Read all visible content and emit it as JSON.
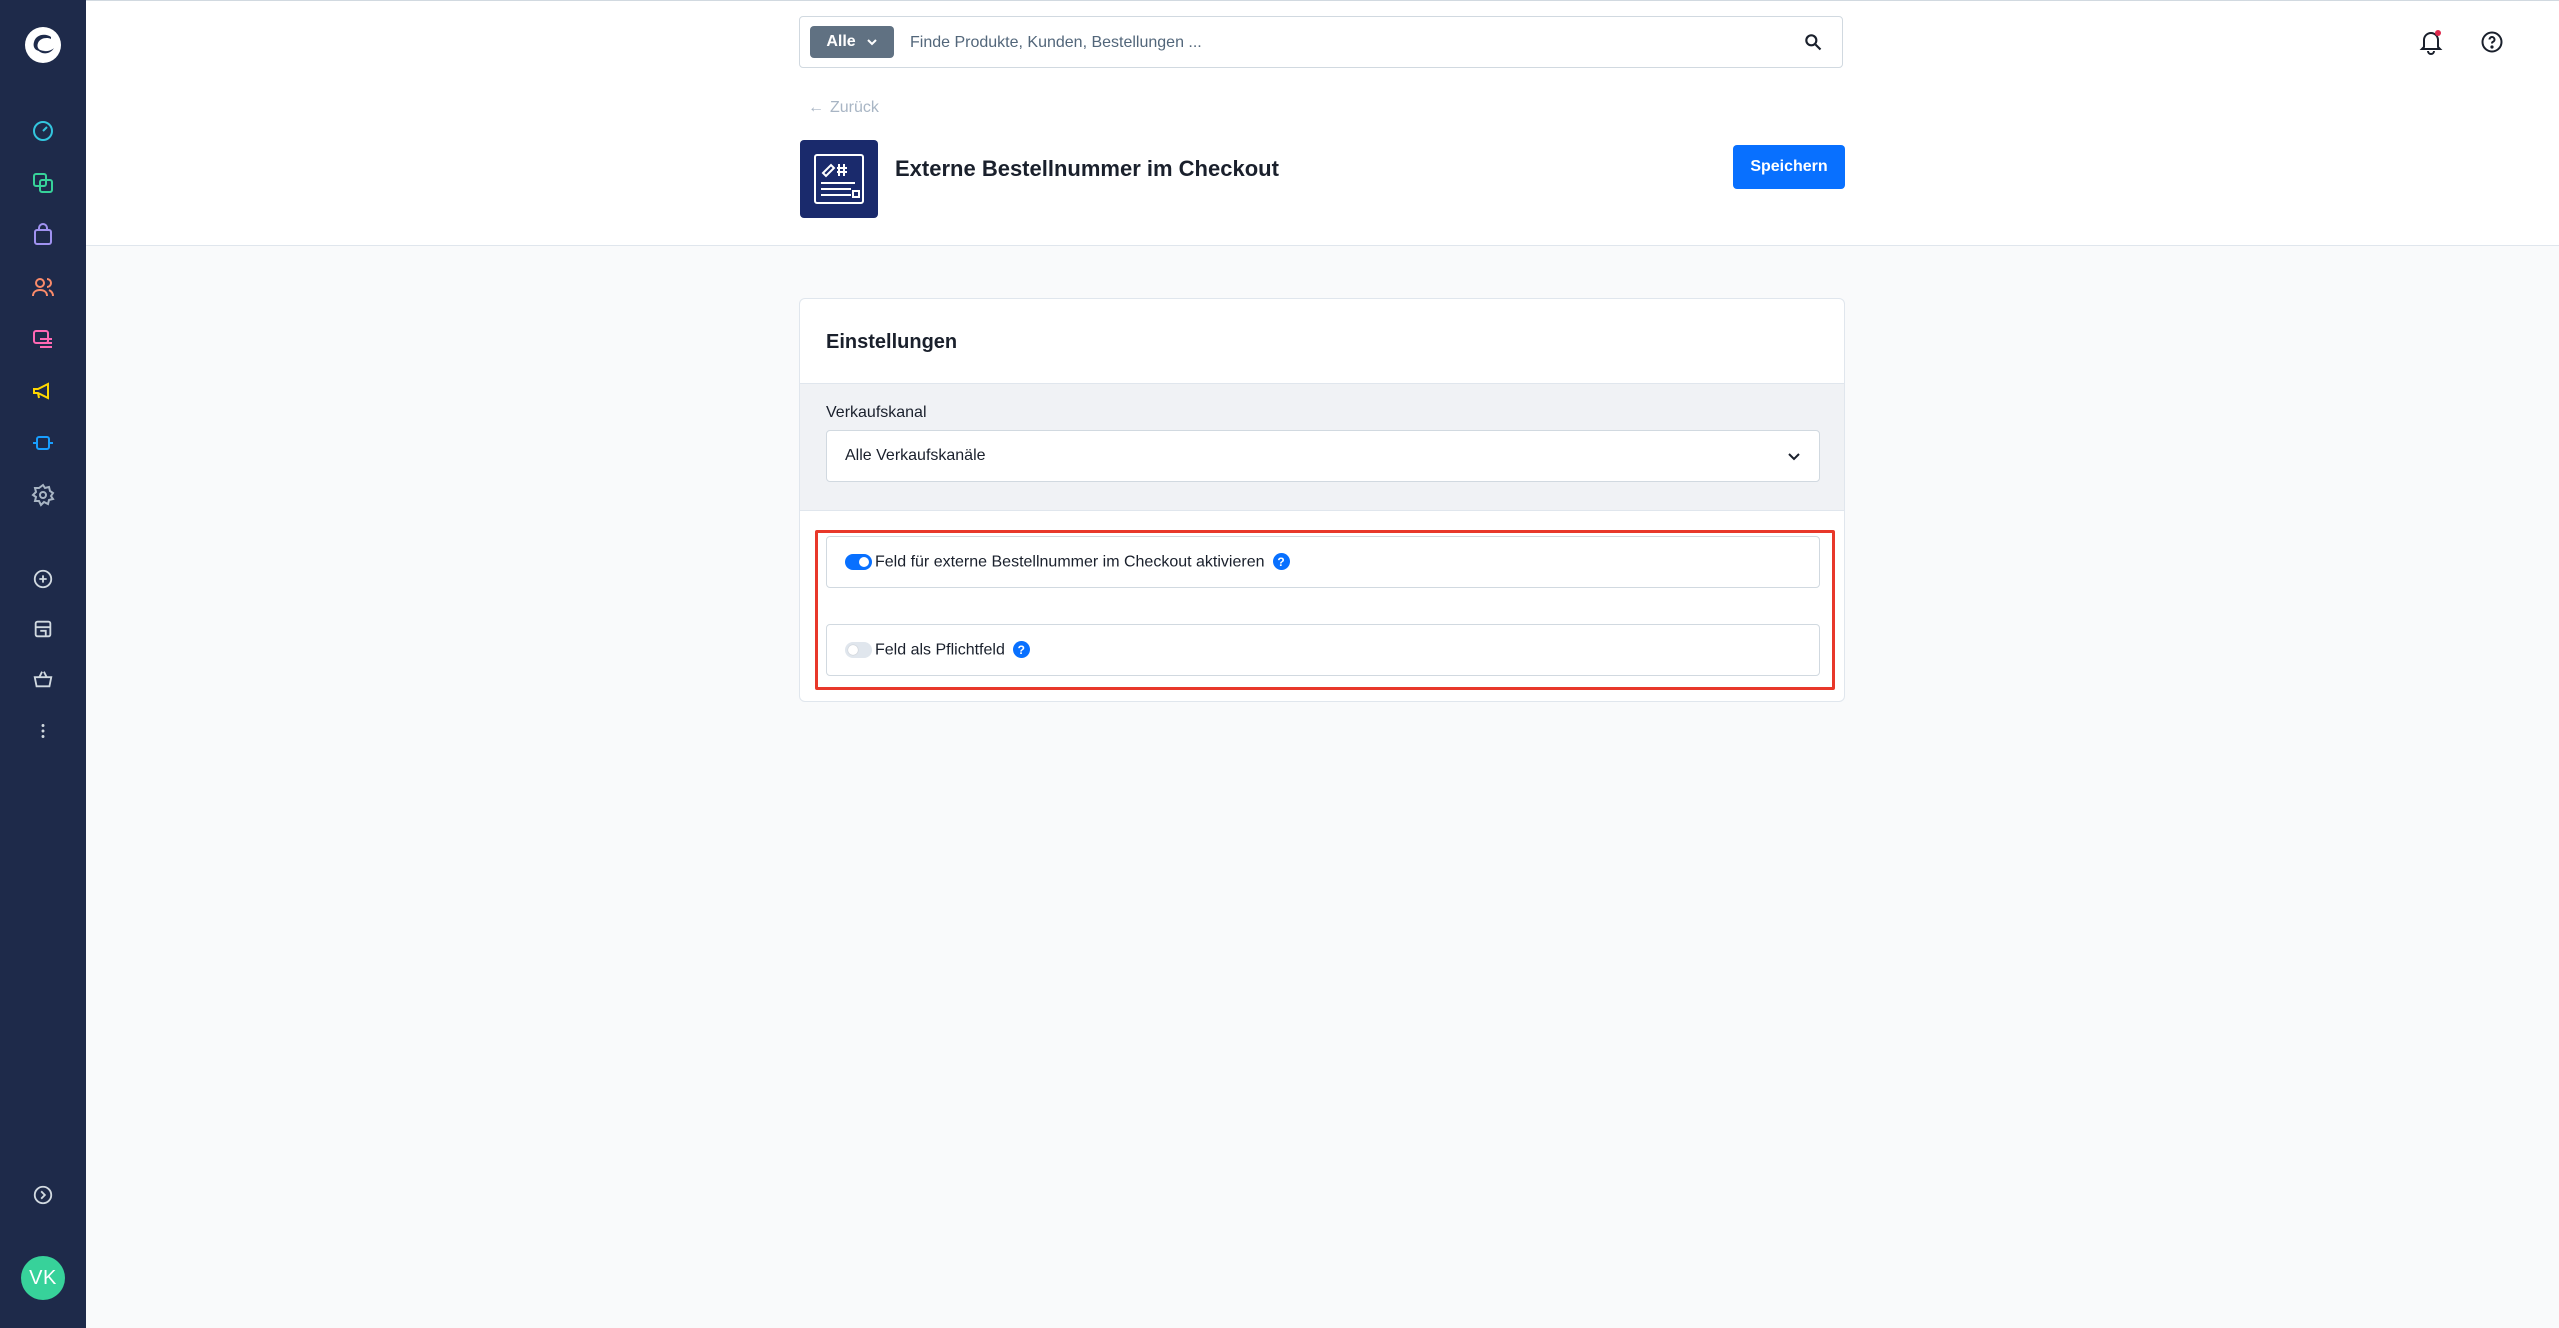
{
  "search": {
    "type_label": "Alle",
    "placeholder": "Finde Produkte, Kunden, Bestellungen ..."
  },
  "header": {
    "back_label": "Zurück",
    "title": "Externe Bestellnummer im Checkout",
    "save_label": "Speichern"
  },
  "card": {
    "title": "Einstellungen",
    "sales_channel_label": "Verkaufskanal",
    "sales_channel_value": "Alle Verkaufskanäle"
  },
  "toggles": [
    {
      "label": "Feld für externe Bestellnummer im Checkout aktivieren",
      "enabled": true
    },
    {
      "label": "Feld als Pflichtfeld",
      "enabled": false
    }
  ],
  "user": {
    "initials": "VK"
  },
  "colors": {
    "sidebar": "#1e2a4a",
    "primary": "#0870ff",
    "highlight": "#e8382a",
    "avatar": "#37d29a"
  }
}
